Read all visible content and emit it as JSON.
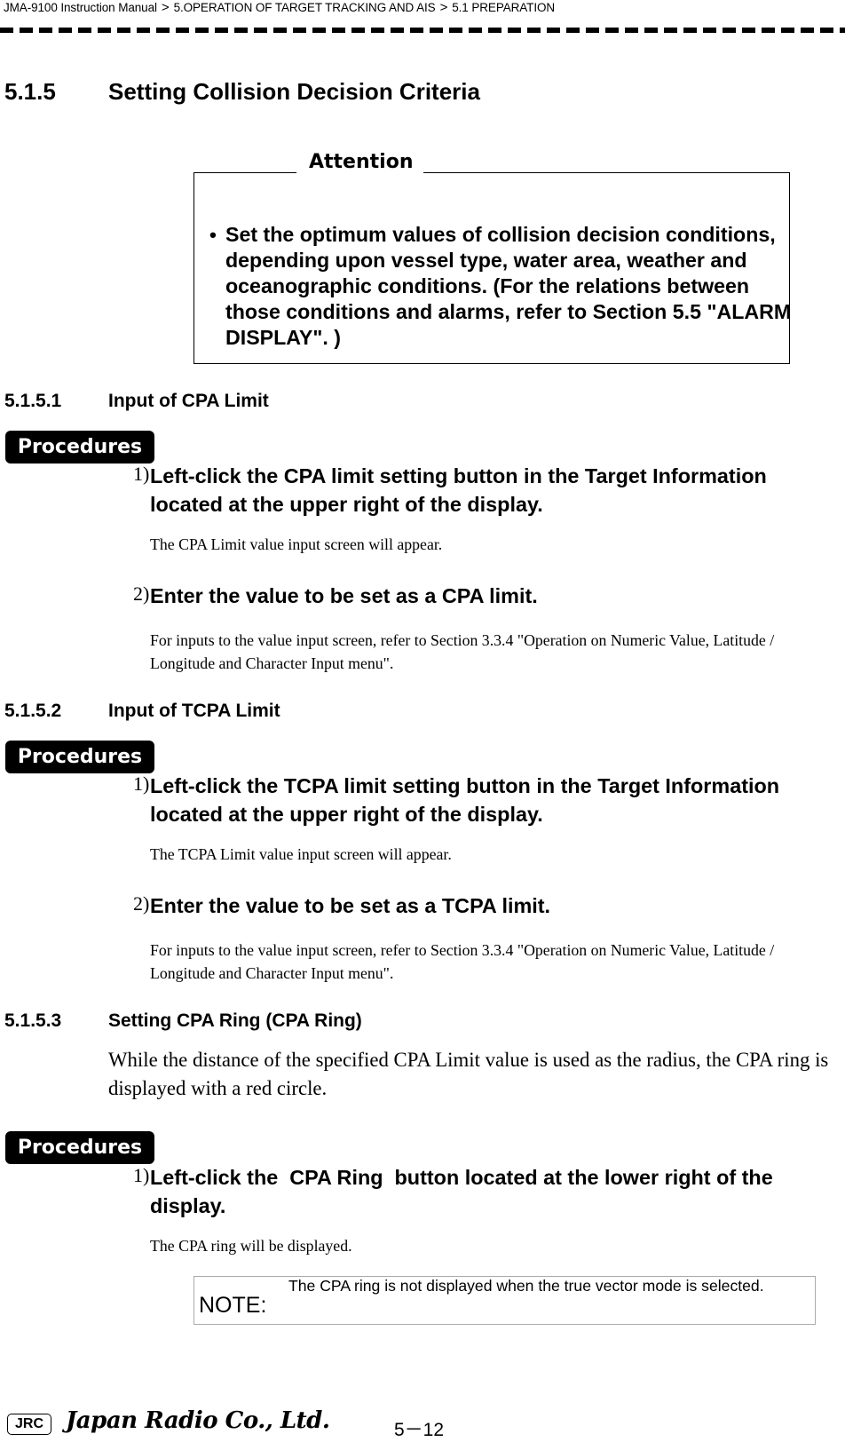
{
  "header": {
    "breadcrumb": [
      "JMA-9100 Instruction Manual",
      "5.OPERATION OF TARGET TRACKING AND AIS",
      "5.1  PREPARATION"
    ],
    "separator": ">"
  },
  "section": {
    "number": "5.1.5",
    "title": "Setting Collision Decision Criteria"
  },
  "attention": {
    "title": "Attention",
    "bullet": "•",
    "text": "Set the optimum values of collision decision conditions, depending upon vessel type, water area, weather and oceanographic conditions. (For the relations between those conditions and alarms, refer to Section 5.5 \"ALARM DISPLAY\". )"
  },
  "subsections": [
    {
      "number": "5.1.5.1",
      "title": "Input of CPA Limit",
      "procedures_label": "Procedures",
      "steps": [
        {
          "num": "1)",
          "text": "Left-click the CPA limit setting button in the Target Information located at the upper right of the display.",
          "note": "The CPA Limit value input screen will appear."
        },
        {
          "num": "2)",
          "text": "Enter the value to be set as a CPA limit.",
          "note": "For inputs to the value input screen, refer to Section 3.3.4 \"Operation on Numeric Value, Latitude / Longitude and Character Input menu\"."
        }
      ]
    },
    {
      "number": "5.1.5.2",
      "title": "Input of TCPA Limit",
      "procedures_label": "Procedures",
      "steps": [
        {
          "num": "1)",
          "text": "Left-click the TCPA limit setting button in the Target Information located at the upper right of the display.",
          "note": "The TCPA Limit value input screen will appear."
        },
        {
          "num": "2)",
          "text": "Enter the value to be set as a TCPA limit.",
          "note": "For inputs to the value input screen, refer to Section 3.3.4 \"Operation on Numeric Value, Latitude / Longitude and Character Input menu\"."
        }
      ]
    },
    {
      "number": "5.1.5.3",
      "title": "Setting CPA Ring (CPA Ring)",
      "intro": "While the distance of the specified CPA Limit value is used as the radius, the CPA ring is displayed with a red circle.",
      "procedures_label": "Procedures",
      "steps": [
        {
          "num": "1)",
          "text": "Left-click the  CPA Ring  button located at the lower right of the display.",
          "note": "The CPA ring will be displayed."
        }
      ],
      "note_box": {
        "label": "NOTE:",
        "text": "The CPA ring is not displayed when the true vector mode is selected."
      }
    }
  ],
  "footer": {
    "logo": "JRC",
    "company": "Japan Radio Co., Ltd.",
    "page": "5－12"
  }
}
